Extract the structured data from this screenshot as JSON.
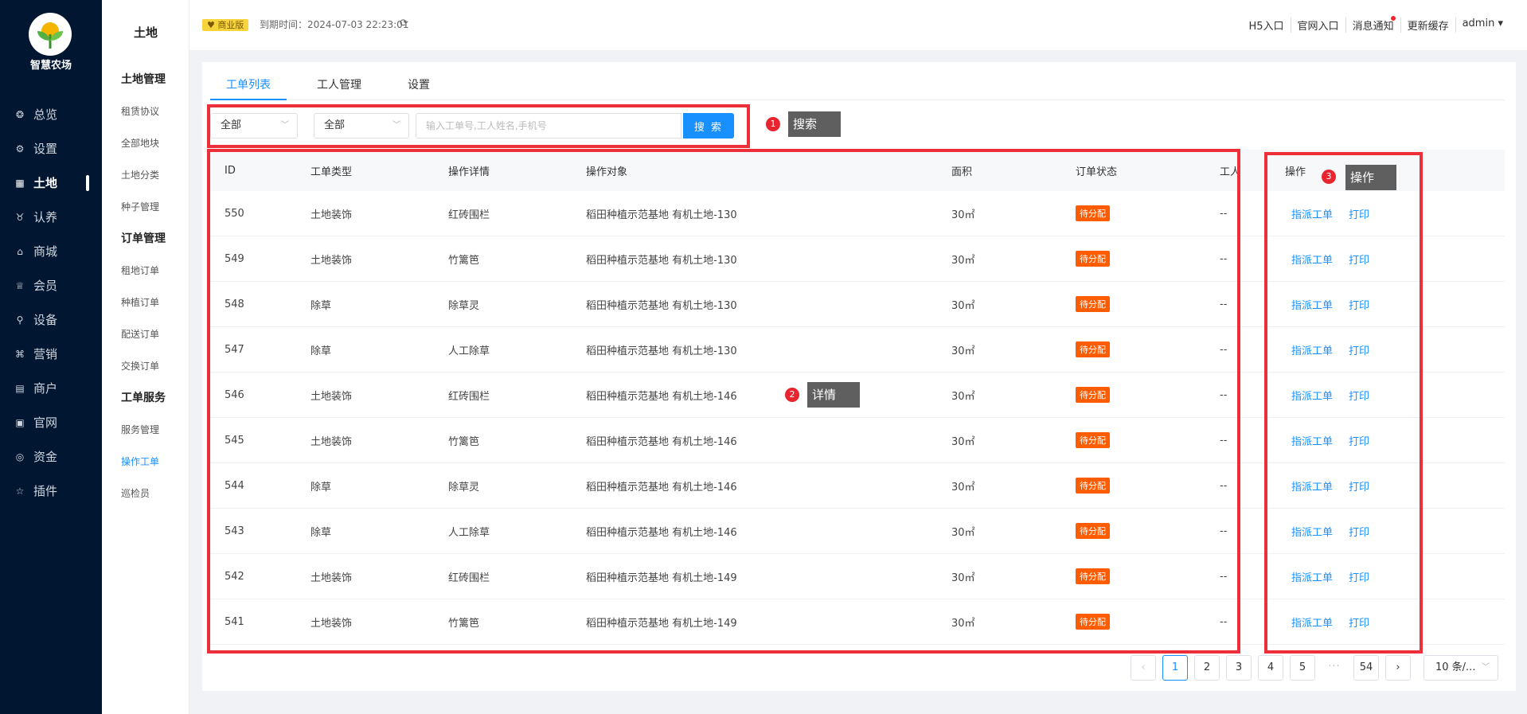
{
  "brand": {
    "name": "智慧农场"
  },
  "nav": [
    {
      "label": "总览",
      "icon": "dashboard-icon",
      "glyph": "❂",
      "active": false
    },
    {
      "label": "设置",
      "icon": "settings-icon",
      "glyph": "⚙",
      "active": false
    },
    {
      "label": "土地",
      "icon": "grid-icon",
      "glyph": "▦",
      "active": true
    },
    {
      "label": "认养",
      "icon": "adopt-icon",
      "glyph": "♉",
      "active": false
    },
    {
      "label": "商城",
      "icon": "shop-icon",
      "glyph": "⌂",
      "active": false
    },
    {
      "label": "会员",
      "icon": "crown-icon",
      "glyph": "♕",
      "active": false
    },
    {
      "label": "设备",
      "icon": "location-icon",
      "glyph": "⚲",
      "active": false
    },
    {
      "label": "营销",
      "icon": "marketing-icon",
      "glyph": "⌘",
      "active": false
    },
    {
      "label": "商户",
      "icon": "store-icon",
      "glyph": "▤",
      "active": false
    },
    {
      "label": "官网",
      "icon": "website-icon",
      "glyph": "▣",
      "active": false
    },
    {
      "label": "资金",
      "icon": "money-icon",
      "glyph": "◎",
      "active": false
    },
    {
      "label": "插件",
      "icon": "star-icon",
      "glyph": "☆",
      "active": false
    }
  ],
  "subbar": {
    "title": "土地",
    "items": [
      {
        "label": "土地管理",
        "type": "group"
      },
      {
        "label": "租赁协议",
        "type": "item"
      },
      {
        "label": "全部地块",
        "type": "item"
      },
      {
        "label": "土地分类",
        "type": "item"
      },
      {
        "label": "种子管理",
        "type": "item"
      },
      {
        "label": "订单管理",
        "type": "group"
      },
      {
        "label": "租地订单",
        "type": "item"
      },
      {
        "label": "种植订单",
        "type": "item"
      },
      {
        "label": "配送订单",
        "type": "item"
      },
      {
        "label": "交换订单",
        "type": "item"
      },
      {
        "label": "工单服务",
        "type": "group"
      },
      {
        "label": "服务管理",
        "type": "item"
      },
      {
        "label": "操作工单",
        "type": "item",
        "active": true
      },
      {
        "label": "巡检员",
        "type": "item"
      }
    ]
  },
  "header": {
    "edition": "商业版",
    "expire": "到期时间：2024-07-03 22:23:01",
    "links": [
      "H5入口",
      "官网入口",
      "消息通知",
      "更新缓存",
      "admin"
    ]
  },
  "tabs": [
    "工单列表",
    "工人管理",
    "设置"
  ],
  "filters": {
    "select1": "全部",
    "select2": "全部",
    "placeholder": "输入工单号,工人姓名,手机号",
    "search_label": "搜 索"
  },
  "table": {
    "headers": [
      "ID",
      "工单类型",
      "操作详情",
      "操作对象",
      "面积",
      "订单状态",
      "工人",
      "操作"
    ],
    "rows": [
      {
        "id": "550",
        "type": "土地装饰",
        "detail": "红砖围栏",
        "target": "稻田种植示范基地 有机土地-130",
        "area": "30㎡",
        "status": "待分配",
        "worker": "--"
      },
      {
        "id": "549",
        "type": "土地装饰",
        "detail": "竹篱笆",
        "target": "稻田种植示范基地 有机土地-130",
        "area": "30㎡",
        "status": "待分配",
        "worker": "--"
      },
      {
        "id": "548",
        "type": "除草",
        "detail": "除草灵",
        "target": "稻田种植示范基地 有机土地-130",
        "area": "30㎡",
        "status": "待分配",
        "worker": "--"
      },
      {
        "id": "547",
        "type": "除草",
        "detail": "人工除草",
        "target": "稻田种植示范基地 有机土地-130",
        "area": "30㎡",
        "status": "待分配",
        "worker": "--"
      },
      {
        "id": "546",
        "type": "土地装饰",
        "detail": "红砖围栏",
        "target": "稻田种植示范基地 有机土地-146",
        "area": "30㎡",
        "status": "待分配",
        "worker": "--"
      },
      {
        "id": "545",
        "type": "土地装饰",
        "detail": "竹篱笆",
        "target": "稻田种植示范基地 有机土地-146",
        "area": "30㎡",
        "status": "待分配",
        "worker": "--"
      },
      {
        "id": "544",
        "type": "除草",
        "detail": "除草灵",
        "target": "稻田种植示范基地 有机土地-146",
        "area": "30㎡",
        "status": "待分配",
        "worker": "--"
      },
      {
        "id": "543",
        "type": "除草",
        "detail": "人工除草",
        "target": "稻田种植示范基地 有机土地-146",
        "area": "30㎡",
        "status": "待分配",
        "worker": "--"
      },
      {
        "id": "542",
        "type": "土地装饰",
        "detail": "红砖围栏",
        "target": "稻田种植示范基地 有机土地-149",
        "area": "30㎡",
        "status": "待分配",
        "worker": "--"
      },
      {
        "id": "541",
        "type": "土地装饰",
        "detail": "竹篱笆",
        "target": "稻田种植示范基地 有机土地-149",
        "area": "30㎡",
        "status": "待分配",
        "worker": "--"
      }
    ],
    "actions": {
      "assign": "指派工单",
      "print": "打印"
    }
  },
  "annotations": [
    {
      "num": "1",
      "label": "搜索"
    },
    {
      "num": "2",
      "label": "详情"
    },
    {
      "num": "3",
      "label": "操作"
    }
  ],
  "pagination": {
    "pages": [
      "1",
      "2",
      "3",
      "4",
      "5"
    ],
    "more": "···",
    "last": "54",
    "current": "1",
    "page_size": "10 条/..."
  },
  "colors": {
    "sidebar": "#011631",
    "accent": "#1890ff",
    "status": "#ff5c00",
    "annotation": "#ed2f3a"
  }
}
